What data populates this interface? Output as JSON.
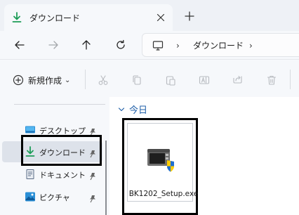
{
  "window": {
    "tab_title": "ダウンロード",
    "new_tab_symbol": "+",
    "close_symbol": "✕"
  },
  "navigation": {
    "back_icon": "arrow-left-icon",
    "forward_icon": "arrow-right-icon",
    "up_icon": "arrow-up-icon",
    "refresh_icon": "refresh-icon"
  },
  "address": {
    "root_icon": "computer-icon",
    "separator": "›",
    "current": "ダウンロード"
  },
  "toolbar": {
    "new_label": "新規作成",
    "new_dropdown": "⌄",
    "actions": [
      "cut-icon",
      "copy-icon",
      "paste-icon",
      "rename-icon",
      "share-icon",
      "delete-icon"
    ]
  },
  "sidebar": {
    "items": [
      {
        "label": "デスクトップ",
        "icon": "desktop-icon",
        "pinned": true
      },
      {
        "label": "ダウンロード",
        "icon": "download-icon",
        "pinned": true,
        "selected": true
      },
      {
        "label": "ドキュメント",
        "icon": "document-icon",
        "pinned": true
      },
      {
        "label": "ピクチャ",
        "icon": "pictures-icon",
        "pinned": true
      }
    ]
  },
  "content": {
    "group_label": "今日",
    "files": [
      {
        "name": "BK1202_Setup.exe",
        "icon": "installer-exe-icon",
        "highlighted": true
      }
    ]
  },
  "colors": {
    "accent_download": "#1c9c57",
    "group_header": "#1f5fa8",
    "selected_bg": "#dde2ea",
    "highlight_border": "#000000"
  }
}
